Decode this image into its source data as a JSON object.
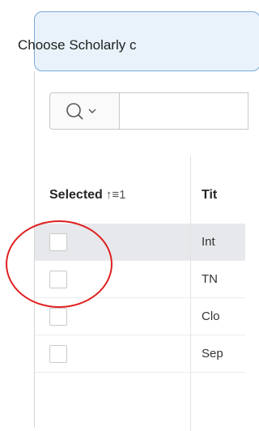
{
  "region": {
    "title": "Choose Scholarly c"
  },
  "toolbar": {
    "search_icon": "search-icon",
    "dropdown_icon": "chevron-down-icon"
  },
  "table": {
    "columns": [
      {
        "label": "Selected",
        "sort_indicator": "↑≡1"
      },
      {
        "label": "Tit"
      }
    ],
    "rows": [
      {
        "checked": false,
        "title": "Int",
        "highlight": true
      },
      {
        "checked": false,
        "title": "TN",
        "highlight": false
      },
      {
        "checked": false,
        "title": "Clo",
        "highlight": false
      },
      {
        "checked": false,
        "title": "Sep",
        "highlight": false
      }
    ]
  },
  "annotation": {
    "shape": "circle",
    "color": "#e02020"
  }
}
